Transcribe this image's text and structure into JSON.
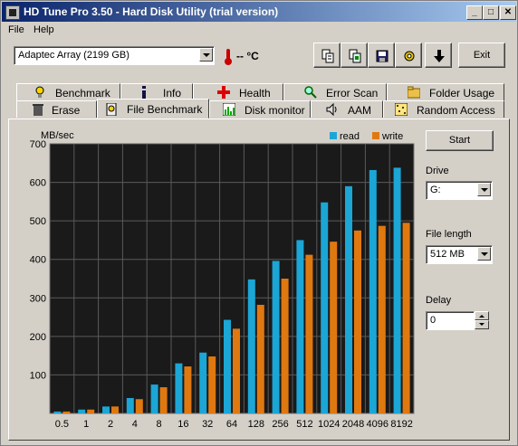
{
  "window": {
    "title": "HD Tune Pro 3.50 - Hard Disk Utility (trial version)",
    "minimize": "_",
    "maximize": "□",
    "close": "✕"
  },
  "menu": [
    "File",
    "Help"
  ],
  "toolbar": {
    "drive_select": "Adaptec Array (2199 GB)",
    "temperature": "-- °C",
    "exit_label": "Exit",
    "icons": [
      "copy-text-icon",
      "copy-image-icon",
      "save-icon",
      "options-icon",
      "download-icon"
    ]
  },
  "tabs_top": [
    "Benchmark",
    "Info",
    "Health",
    "Error Scan",
    "Folder Usage"
  ],
  "tabs_bottom": [
    "Erase",
    "File Benchmark",
    "Disk monitor",
    "AAM",
    "Random Access"
  ],
  "active_tab": "File Benchmark",
  "sidebar": {
    "start_label": "Start",
    "drive_label": "Drive",
    "drive_value": "G:",
    "file_length_label": "File length",
    "file_length_value": "512 MB",
    "delay_label": "Delay",
    "delay_value": "0"
  },
  "colors": {
    "read": "#1ba6d6",
    "write": "#e07810",
    "plot_bg": "#1a1a1a",
    "grid": "#5a5a5a"
  },
  "chart_data": {
    "type": "bar",
    "ylabel": "MB/sec",
    "ylim": [
      0,
      700
    ],
    "yticks": [
      100,
      200,
      300,
      400,
      500,
      600,
      700
    ],
    "categories": [
      "0.5",
      "1",
      "2",
      "4",
      "8",
      "16",
      "32",
      "64",
      "128",
      "256",
      "512",
      "1024",
      "2048",
      "4096",
      "8192"
    ],
    "series": [
      {
        "name": "read",
        "values": [
          5,
          10,
          18,
          40,
          75,
          130,
          158,
          243,
          348,
          396,
          450,
          548,
          590,
          632,
          638
        ]
      },
      {
        "name": "write",
        "values": [
          5,
          10,
          18,
          37,
          68,
          122,
          148,
          220,
          282,
          350,
          412,
          446,
          475,
          487,
          495
        ]
      }
    ],
    "legend": "top-right",
    "grid": true
  }
}
